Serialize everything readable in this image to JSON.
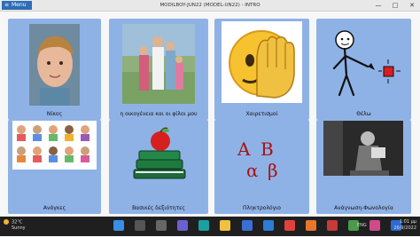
{
  "window": {
    "menu_label": "Menu",
    "title": "MODILBOY-JUN22 (MODEL-UN22) - INTRO",
    "controls": {
      "minimize": "—",
      "maximize": "□",
      "close": "✕"
    }
  },
  "tiles": [
    {
      "label": "Νίκος",
      "icon": "boy-portrait-photo"
    },
    {
      "label": "η οικογένεια και οι φίλοι μου",
      "icon": "family-photo"
    },
    {
      "label": "Χαιρετισμοί",
      "icon": "waving-emoji-icon"
    },
    {
      "label": "Θέλω",
      "icon": "stick-figure-want-icon"
    },
    {
      "label": "Ανάγκες",
      "icon": "needs-people-icon"
    },
    {
      "label": "Βασικές δεξιότητες",
      "icon": "books-apple-icon"
    },
    {
      "label": "Πληκτρολόγιο",
      "icon": "greek-letters-icon"
    },
    {
      "label": "Ανάγνωση-Φωνολογία",
      "icon": "reading-photo"
    }
  ],
  "taskbar": {
    "weather_temp": "32°C",
    "weather_text": "Sunny",
    "language": "ENG",
    "time": "1:01 μμ",
    "date": "26/9/2022",
    "apps": [
      "start-icon",
      "search-icon",
      "task-view-icon",
      "chat-icon",
      "edge-icon",
      "file-explorer-icon",
      "store-icon",
      "mail-icon",
      "chrome-icon",
      "firefox-icon",
      "app-icon",
      "app-icon",
      "app-icon",
      "app-icon",
      "app-icon",
      "app-icon",
      "app-icon",
      "app-icon"
    ],
    "colors": {
      "bar": "#1f1f1f",
      "tile": "#8fb2e6",
      "menu": "#2f6db5"
    }
  }
}
